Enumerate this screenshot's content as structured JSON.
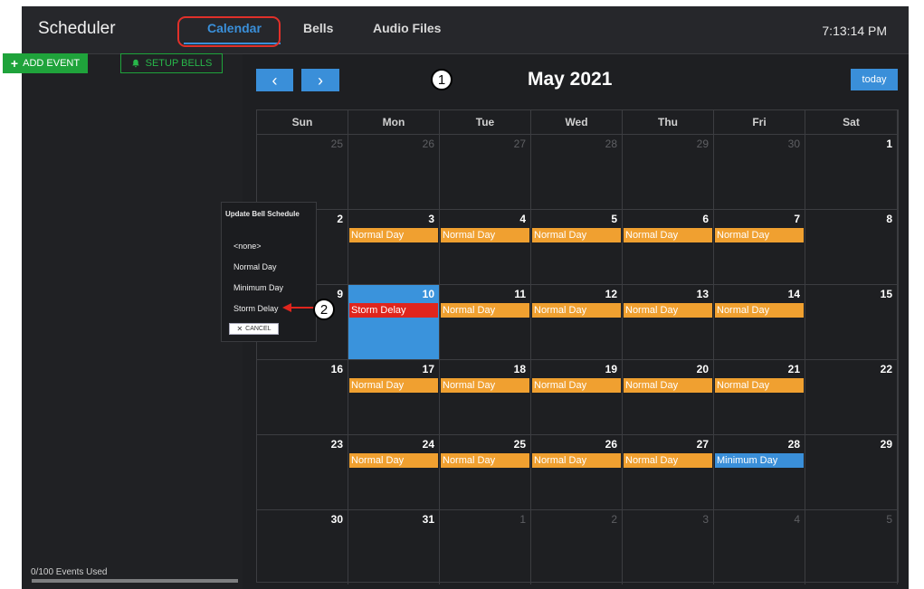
{
  "app": {
    "title": "Scheduler",
    "clock": "7:13:14 PM"
  },
  "nav": {
    "tabs": [
      {
        "label": "Calendar"
      },
      {
        "label": "Bells"
      },
      {
        "label": "Audio Files"
      }
    ]
  },
  "left_panel": {
    "add_event": "ADD EVENT",
    "setup_bells": "SETUP BELLS",
    "events_used": "0/100 Events Used"
  },
  "calendar": {
    "title": "May 2021",
    "prev_icon": "‹",
    "next_icon": "›",
    "today_label": "today",
    "days_of_week": [
      "Sun",
      "Mon",
      "Tue",
      "Wed",
      "Thu",
      "Fri",
      "Sat"
    ],
    "weeks": [
      [
        {
          "day": "25",
          "other": true
        },
        {
          "day": "26",
          "other": true
        },
        {
          "day": "27",
          "other": true
        },
        {
          "day": "28",
          "other": true
        },
        {
          "day": "29",
          "other": true
        },
        {
          "day": "30",
          "other": true
        },
        {
          "day": "1"
        }
      ],
      [
        {
          "day": "2"
        },
        {
          "day": "3",
          "event": "Normal Day",
          "color": "#f0a030"
        },
        {
          "day": "4",
          "event": "Normal Day",
          "color": "#f0a030"
        },
        {
          "day": "5",
          "event": "Normal Day",
          "color": "#f0a030"
        },
        {
          "day": "6",
          "event": "Normal Day",
          "color": "#f0a030"
        },
        {
          "day": "7",
          "event": "Normal Day",
          "color": "#f0a030"
        },
        {
          "day": "8"
        }
      ],
      [
        {
          "day": "9"
        },
        {
          "day": "10",
          "event": "Storm Delay",
          "color": "#e0251d",
          "today": true
        },
        {
          "day": "11",
          "event": "Normal Day",
          "color": "#f0a030"
        },
        {
          "day": "12",
          "event": "Normal Day",
          "color": "#f0a030"
        },
        {
          "day": "13",
          "event": "Normal Day",
          "color": "#f0a030"
        },
        {
          "day": "14",
          "event": "Normal Day",
          "color": "#f0a030"
        },
        {
          "day": "15"
        }
      ],
      [
        {
          "day": "16"
        },
        {
          "day": "17",
          "event": "Normal Day",
          "color": "#f0a030"
        },
        {
          "day": "18",
          "event": "Normal Day",
          "color": "#f0a030"
        },
        {
          "day": "19",
          "event": "Normal Day",
          "color": "#f0a030"
        },
        {
          "day": "20",
          "event": "Normal Day",
          "color": "#f0a030"
        },
        {
          "day": "21",
          "event": "Normal Day",
          "color": "#f0a030"
        },
        {
          "day": "22"
        }
      ],
      [
        {
          "day": "23"
        },
        {
          "day": "24",
          "event": "Normal Day",
          "color": "#f0a030"
        },
        {
          "day": "25",
          "event": "Normal Day",
          "color": "#f0a030"
        },
        {
          "day": "26",
          "event": "Normal Day",
          "color": "#f0a030"
        },
        {
          "day": "27",
          "event": "Normal Day",
          "color": "#f0a030"
        },
        {
          "day": "28",
          "event": "Minimum Day",
          "color": "#3a8fd9"
        },
        {
          "day": "29"
        }
      ],
      [
        {
          "day": "30"
        },
        {
          "day": "31"
        },
        {
          "day": "1",
          "other": true
        },
        {
          "day": "2",
          "other": true
        },
        {
          "day": "3",
          "other": true
        },
        {
          "day": "4",
          "other": true
        },
        {
          "day": "5",
          "other": true
        }
      ]
    ]
  },
  "popup": {
    "title": "Update Bell Schedule",
    "options": [
      "<none>",
      "Normal Day",
      "Minimum Day",
      "Storm Delay"
    ],
    "cancel": "CANCEL"
  },
  "annotations": {
    "marker1": "1",
    "marker2": "2"
  },
  "colors": {
    "accent": "#3a8fd9",
    "green": "#1fa33b",
    "normal_day": "#f0a030",
    "storm_delay": "#e0251d",
    "minimum_day": "#3a8fd9",
    "highlight": "#e0302a"
  }
}
